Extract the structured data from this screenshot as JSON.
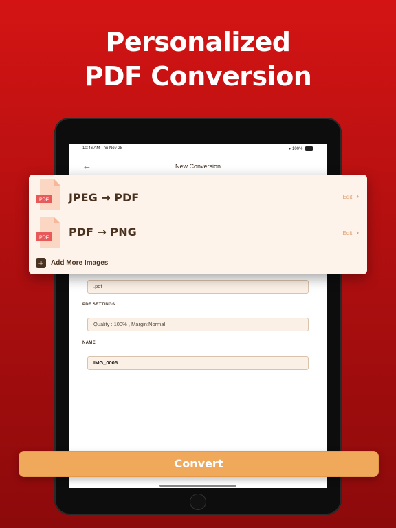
{
  "headline": {
    "line1": "Personalized",
    "line2": "PDF Conversion"
  },
  "status_bar": {
    "time": "10:46 AM  Thu Nov 28",
    "indicators": "▾ 100%"
  },
  "nav": {
    "back_icon": "arrow-left-icon",
    "title": "New Conversion"
  },
  "conversions": [
    {
      "title": "JPEG → PDF",
      "badge": "PDF",
      "edit_label": "Edit",
      "icon": "pdf-file-icon"
    },
    {
      "title": "PDF → PNG",
      "badge": "PDF",
      "edit_label": "Edit",
      "icon": "pdf-file-icon"
    }
  ],
  "add_more": {
    "icon": "plus-icon",
    "label": "Add More Images"
  },
  "form": {
    "extension_value": ".pdf",
    "pdf_settings_label": "PDF SETTINGS",
    "pdf_settings_value": "Quality : 100% , Margin:Normal",
    "name_label": "NAME",
    "name_value": "IMG_0005"
  },
  "convert_button": {
    "label": "Convert"
  },
  "colors": {
    "background_red": "#c71212",
    "card": "#fdf3ea",
    "accent_orange": "#f0a85a",
    "text_brown": "#4a3220",
    "badge_red": "#e85a5a"
  }
}
